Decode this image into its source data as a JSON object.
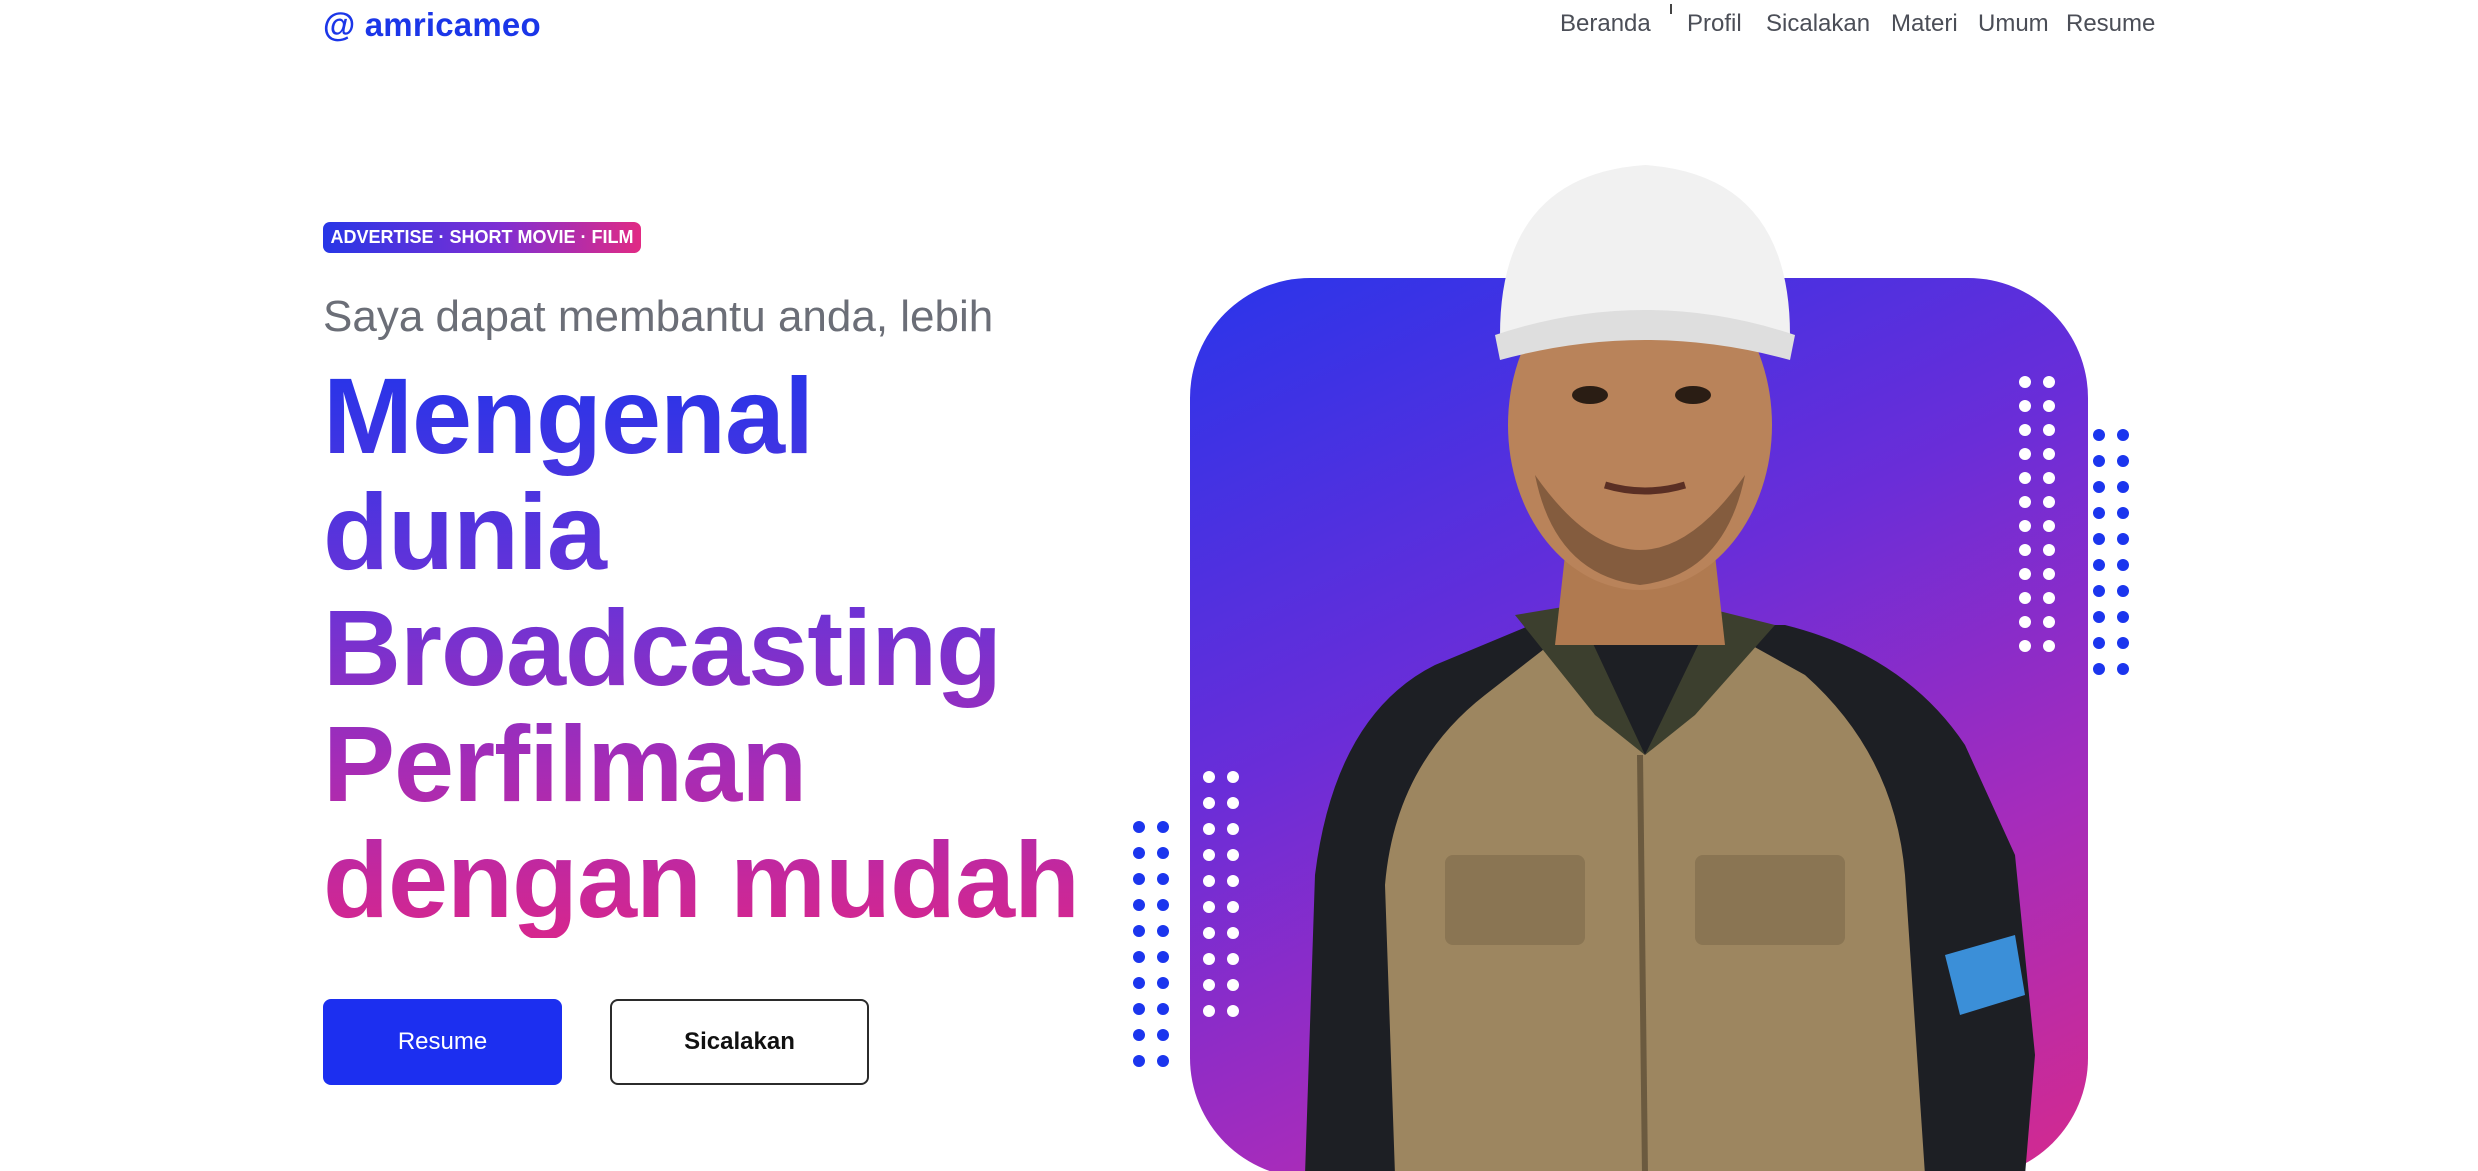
{
  "header": {
    "logo": "@ amricameo",
    "nav": [
      "Beranda",
      "Profil",
      "Sicalakan",
      "Materi",
      "Umum",
      "Resume"
    ]
  },
  "hero": {
    "tag": "ADVERTISE · SHORT MOVIE · FILM",
    "subheading": "Saya dapat membantu anda, lebih",
    "headline": [
      "Mengenal",
      "dunia",
      "Broadcasting",
      "Perfilman",
      "dengan mudah"
    ],
    "buttons": {
      "primary": "Resume",
      "secondary": "Sicalakan"
    }
  },
  "colors": {
    "brand_blue": "#1c2ff0",
    "gradient_start": "#2a35ea",
    "gradient_mid": "#8a2fd0",
    "gradient_end": "#d52a8d",
    "dot_blue": "#1b35ee",
    "dot_white": "#ffffff"
  },
  "icons": {
    "portrait": "man-in-white-cap-photo"
  }
}
